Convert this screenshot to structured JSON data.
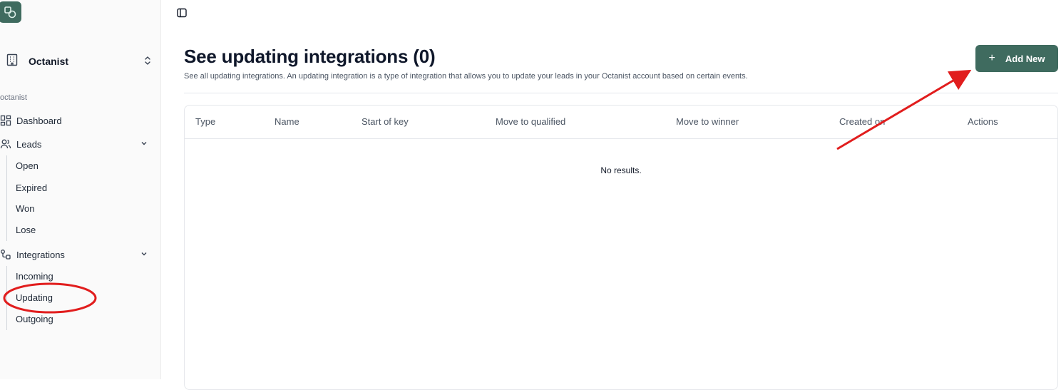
{
  "sidebar": {
    "org_name": "Octanist",
    "section_label": "octanist",
    "nav": {
      "dashboard": "Dashboard",
      "leads": "Leads",
      "integrations": "Integrations"
    },
    "leads_sub": [
      "Open",
      "Expired",
      "Won",
      "Lose"
    ],
    "integrations_sub": [
      "Incoming",
      "Updating",
      "Outgoing"
    ]
  },
  "header": {
    "title": "See updating integrations (0)",
    "description": "See all updating integrations. An updating integration is a type of integration that allows you to update your leads in your Octanist account based on certain events.",
    "add_button_label": "Add New"
  },
  "table": {
    "columns": [
      "Type",
      "Name",
      "Start of key",
      "Move to qualified",
      "Move to winner",
      "Created on",
      "Actions"
    ],
    "empty_text": "No results."
  },
  "colors": {
    "accent": "#3f6b5f",
    "annotation": "#e11d1d"
  },
  "icons": [
    "logo-icon",
    "building-icon",
    "chevron-updown-icon",
    "dashboard-icon",
    "users-icon",
    "chevron-down-icon",
    "integrations-icon",
    "sidebar-toggle-icon",
    "plus-icon"
  ]
}
